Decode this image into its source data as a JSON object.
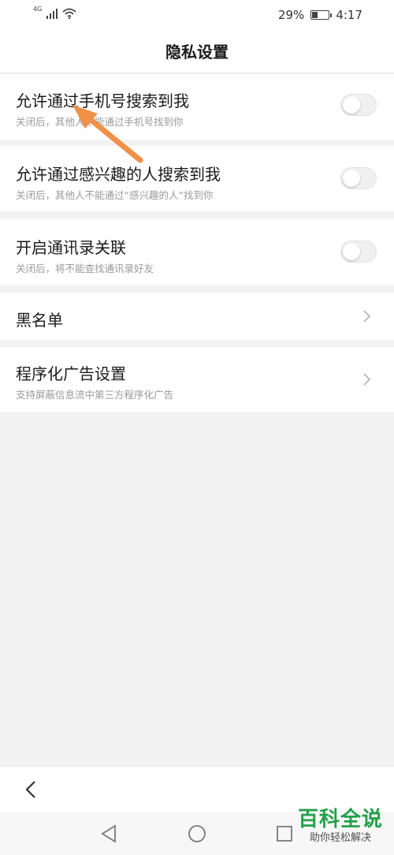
{
  "status_bar": {
    "network": "4G",
    "battery": "29%",
    "battery_level": 0.29,
    "time": "4:17"
  },
  "header": {
    "title": "隐私设置"
  },
  "settings": [
    {
      "title": "允许通过手机号搜索到我",
      "subtitle": "关闭后，其他人不能通过手机号找到你",
      "control": "toggle",
      "on": false
    },
    {
      "title": "允许通过感兴趣的人搜索到我",
      "subtitle": "关闭后，其他人不能通过“感兴趣的人”找到你",
      "control": "toggle",
      "on": false
    },
    {
      "title": "开启通讯录关联",
      "subtitle": "关闭后，将不能查找通讯录好友",
      "control": "toggle",
      "on": false
    },
    {
      "title": "黑名单",
      "control": "chevron"
    },
    {
      "title": "程序化广告设置",
      "subtitle": "支持屏蔽信息流中第三方程序化广告",
      "control": "chevron"
    }
  ],
  "icons": {
    "back": "back-arrow-icon",
    "nav_back": "triangle-back-icon",
    "nav_home": "circle-home-icon",
    "nav_recent": "square-recent-icon",
    "annotation": "orange-arrow"
  },
  "watermark": {
    "title": "百科全说",
    "subtitle": "助你轻松解决"
  },
  "colors": {
    "annotation_arrow": "#f0914a",
    "watermark_green": "#23a14a",
    "background": "#f2f2f2"
  }
}
